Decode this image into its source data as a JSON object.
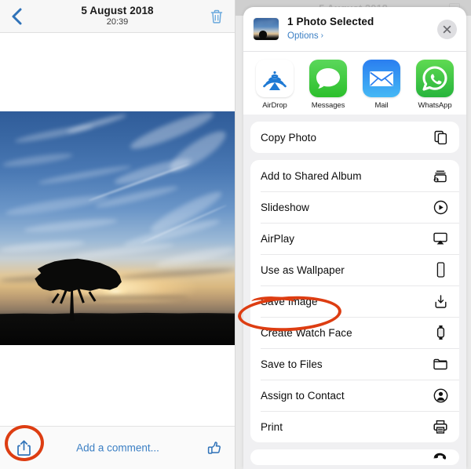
{
  "left_panel": {
    "header": {
      "back_icon": "chevron-left-icon",
      "date": "5 August 2018",
      "time": "20:39",
      "delete_icon": "trash-icon"
    },
    "photo": {
      "alt": "Sunset landscape with silhouetted lone tree and cirrus clouds"
    },
    "bottom_bar": {
      "share_icon": "share-up-arrow-icon",
      "comment_placeholder": "Add a comment...",
      "like_icon": "thumbs-up-icon"
    },
    "annotation": {
      "share_circle": "red-ellipse-highlight"
    }
  },
  "right_panel": {
    "background_header_text": "5 August 2018",
    "sheet": {
      "title": "1 Photo Selected",
      "options_label": "Options",
      "options_chevron": "›",
      "close_icon": "close-x-icon",
      "thumbnail": "photo-thumbnail",
      "apps": [
        {
          "label": "AirDrop",
          "icon": "airdrop-icon"
        },
        {
          "label": "Messages",
          "icon": "messages-icon"
        },
        {
          "label": "Mail",
          "icon": "mail-icon"
        },
        {
          "label": "WhatsApp",
          "icon": "whatsapp-icon"
        },
        {
          "label": "",
          "icon": "notes-icon"
        }
      ],
      "action_groups": [
        {
          "rows": [
            {
              "label": "Copy Photo",
              "icon": "copy-icon"
            }
          ]
        },
        {
          "rows": [
            {
              "label": "Add to Shared Album",
              "icon": "shared-album-icon"
            },
            {
              "label": "Slideshow",
              "icon": "play-circle-icon"
            },
            {
              "label": "AirPlay",
              "icon": "airplay-icon"
            },
            {
              "label": "Use as Wallpaper",
              "icon": "phone-icon"
            },
            {
              "label": "Save Image",
              "icon": "save-download-icon"
            },
            {
              "label": "Create Watch Face",
              "icon": "watch-icon"
            },
            {
              "label": "Save to Files",
              "icon": "folder-icon"
            },
            {
              "label": "Assign to Contact",
              "icon": "contact-person-icon"
            },
            {
              "label": "Print",
              "icon": "printer-icon"
            }
          ]
        }
      ],
      "partial_row_icon": "telephone-handset-icon"
    },
    "annotation": {
      "save_image_circle": "red-ellipse-highlight"
    }
  },
  "colors": {
    "accent_blue": "#3b7fc4",
    "annotation_red": "#dd3d12",
    "sheet_bg": "#f0f0f2",
    "card_bg": "#ffffff"
  }
}
